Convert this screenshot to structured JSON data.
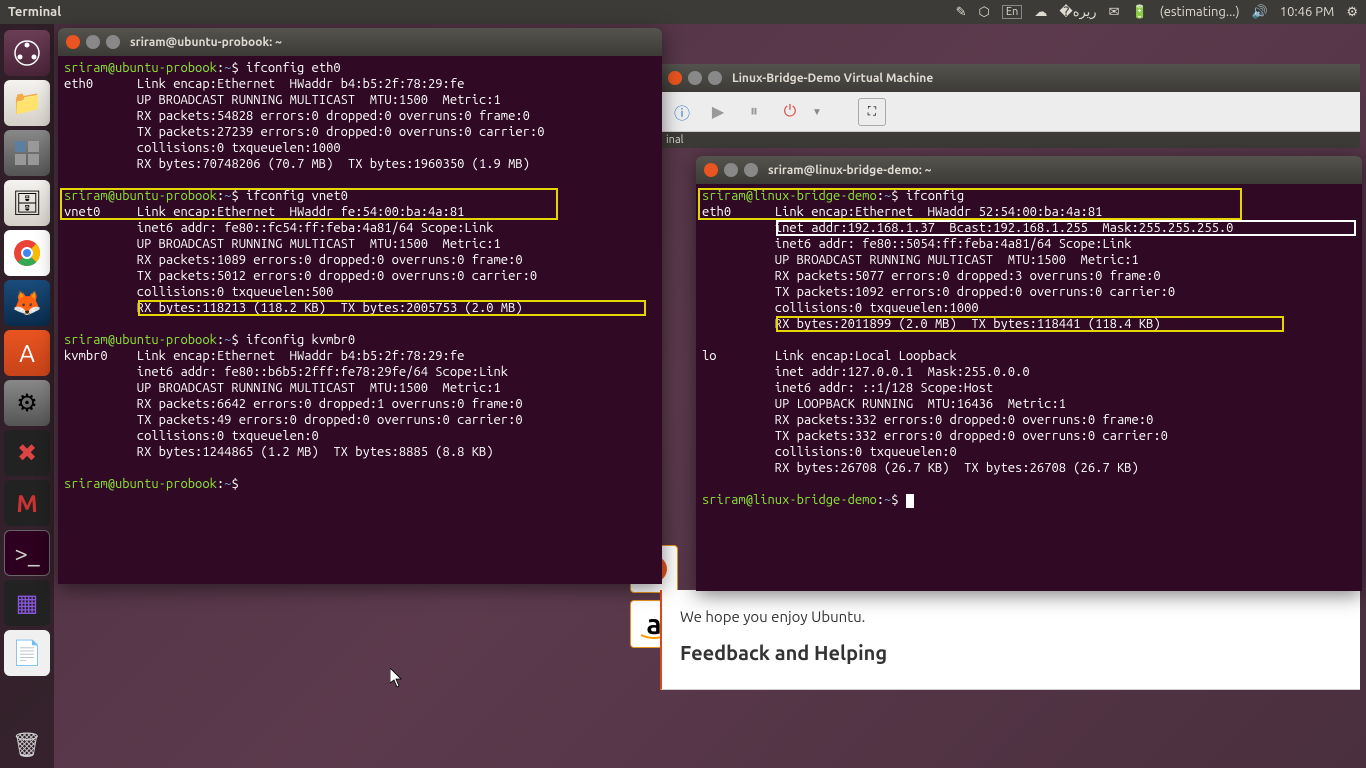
{
  "topbar": {
    "app_title": "Terminal",
    "lang": "En",
    "battery": "(estimating...)",
    "time": "10:46 PM"
  },
  "terminal1": {
    "title": "sriram@ubuntu-probook: ~",
    "prompt_user": "sriram@ubuntu-probook",
    "prompt_path": "~",
    "cmd1": "ifconfig eth0",
    "eth0_l1": "eth0      Link encap:Ethernet  HWaddr b4:b5:2f:78:29:fe  ",
    "eth0_l2": "          UP BROADCAST RUNNING MULTICAST  MTU:1500  Metric:1",
    "eth0_l3": "          RX packets:54828 errors:0 dropped:0 overruns:0 frame:0",
    "eth0_l4": "          TX packets:27239 errors:0 dropped:0 overruns:0 carrier:0",
    "eth0_l5": "          collisions:0 txqueuelen:1000 ",
    "eth0_l6": "          RX bytes:70748206 (70.7 MB)  TX bytes:1960350 (1.9 MB)",
    "cmd2": "ifconfig vnet0",
    "vnet0_l1": "vnet0     Link encap:Ethernet  HWaddr fe:54:00:ba:4a:81  ",
    "vnet0_l2": "          inet6 addr: fe80::fc54:ff:feba:4a81/64 Scope:Link",
    "vnet0_l3": "          UP BROADCAST RUNNING MULTICAST  MTU:1500  Metric:1",
    "vnet0_l4": "          RX packets:1089 errors:0 dropped:0 overruns:0 frame:0",
    "vnet0_l5": "          TX packets:5012 errors:0 dropped:0 overruns:0 carrier:0",
    "vnet0_l6": "          collisions:0 txqueuelen:500 ",
    "vnet0_l7": "          RX bytes:118213 (118.2 KB)  TX bytes:2005753 (2.0 MB)",
    "cmd3": "ifconfig kvmbr0",
    "kvm_l1": "kvmbr0    Link encap:Ethernet  HWaddr b4:b5:2f:78:29:fe  ",
    "kvm_l2": "          inet6 addr: fe80::b6b5:2fff:fe78:29fe/64 Scope:Link",
    "kvm_l3": "          UP BROADCAST RUNNING MULTICAST  MTU:1500  Metric:1",
    "kvm_l4": "          RX packets:6642 errors:0 dropped:1 overruns:0 frame:0",
    "kvm_l5": "          TX packets:49 errors:0 dropped:0 overruns:0 carrier:0",
    "kvm_l6": "          collisions:0 txqueuelen:0 ",
    "kvm_l7": "          RX bytes:1244865 (1.2 MB)  TX bytes:8885 (8.8 KB)"
  },
  "vm": {
    "title": "Linux-Bridge-Demo Virtual Machine",
    "inner_label": "inal"
  },
  "terminal2": {
    "title": "sriram@linux-bridge-demo: ~",
    "prompt_user": "sriram@linux-bridge-demo",
    "prompt_path": "~",
    "cmd1": "ifconfig",
    "eth0_l1": "eth0      Link encap:Ethernet  HWaddr 52:54:00:ba:4a:81  ",
    "eth0_l2": "          inet addr:192.168.1.37  Bcast:192.168.1.255  Mask:255.255.255.0",
    "eth0_l3": "          inet6 addr: fe80::5054:ff:feba:4a81/64 Scope:Link",
    "eth0_l4": "          UP BROADCAST RUNNING MULTICAST  MTU:1500  Metric:1",
    "eth0_l5": "          RX packets:5077 errors:0 dropped:3 overruns:0 frame:0",
    "eth0_l6": "          TX packets:1092 errors:0 dropped:0 overruns:0 carrier:0",
    "eth0_l7": "          collisions:0 txqueuelen:1000 ",
    "eth0_l8": "          RX bytes:2011899 (2.0 MB)  TX bytes:118441 (118.4 KB)",
    "lo_l1": "lo        Link encap:Local Loopback  ",
    "lo_l2": "          inet addr:127.0.0.1  Mask:255.0.0.0",
    "lo_l3": "          inet6 addr: ::1/128 Scope:Host",
    "lo_l4": "          UP LOOPBACK RUNNING  MTU:16436  Metric:1",
    "lo_l5": "          RX packets:332 errors:0 dropped:0 overruns:0 frame:0",
    "lo_l6": "          TX packets:332 errors:0 dropped:0 overruns:0 carrier:0",
    "lo_l7": "          collisions:0 txqueuelen:0 ",
    "lo_l8": "          RX bytes:26708 (26.7 KB)  TX bytes:26708 (26.7 KB)"
  },
  "browser": {
    "hope_text": "We hope you enjoy Ubuntu.",
    "feedback_heading": "Feedback and Helping"
  },
  "amazon_label": "a"
}
